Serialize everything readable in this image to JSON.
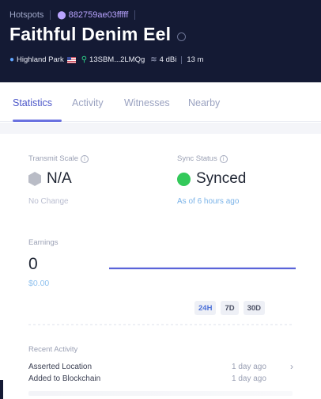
{
  "header": {
    "breadcrumb": "Hotspots",
    "address": "882759ae03fffff",
    "title": "Faithful Denim Eel",
    "location": "Highland Park",
    "owner": "13SBM...2LMQg",
    "gain": "4 dBi",
    "elevation": "13 m"
  },
  "tabs": [
    "Statistics",
    "Activity",
    "Witnesses",
    "Nearby"
  ],
  "active_tab": "Statistics",
  "stats": {
    "transmit_scale_label": "Transmit Scale",
    "transmit_scale_value": "N/A",
    "transmit_scale_sub": "No Change",
    "sync_status_label": "Sync Status",
    "sync_status_value": "Synced",
    "sync_status_sub": "As of 6 hours ago"
  },
  "earnings": {
    "label": "Earnings",
    "value": "0",
    "usd": "$0.00",
    "ranges": [
      "24H",
      "7D",
      "30D"
    ],
    "active_range": "24H"
  },
  "recent_activity": {
    "label": "Recent Activity",
    "items": [
      {
        "text": "Asserted Location",
        "time": "1 day ago"
      },
      {
        "text": "Added to Blockchain",
        "time": "1 day ago"
      }
    ]
  },
  "colors": {
    "header_bg": "#141a34",
    "accent": "#4b56c9",
    "synced_green": "#33c95a",
    "address_purple": "#b9a4ff"
  },
  "icons": {
    "address": "hotspot-pin-icon",
    "location": "location-pin-icon",
    "flag": "us-flag-icon",
    "owner": "owner-icon",
    "antenna": "antenna-icon",
    "info": "info-icon",
    "transmit": "hexagon-icon",
    "sync": "green-dot-icon",
    "chevron": "chevron-right-icon"
  }
}
